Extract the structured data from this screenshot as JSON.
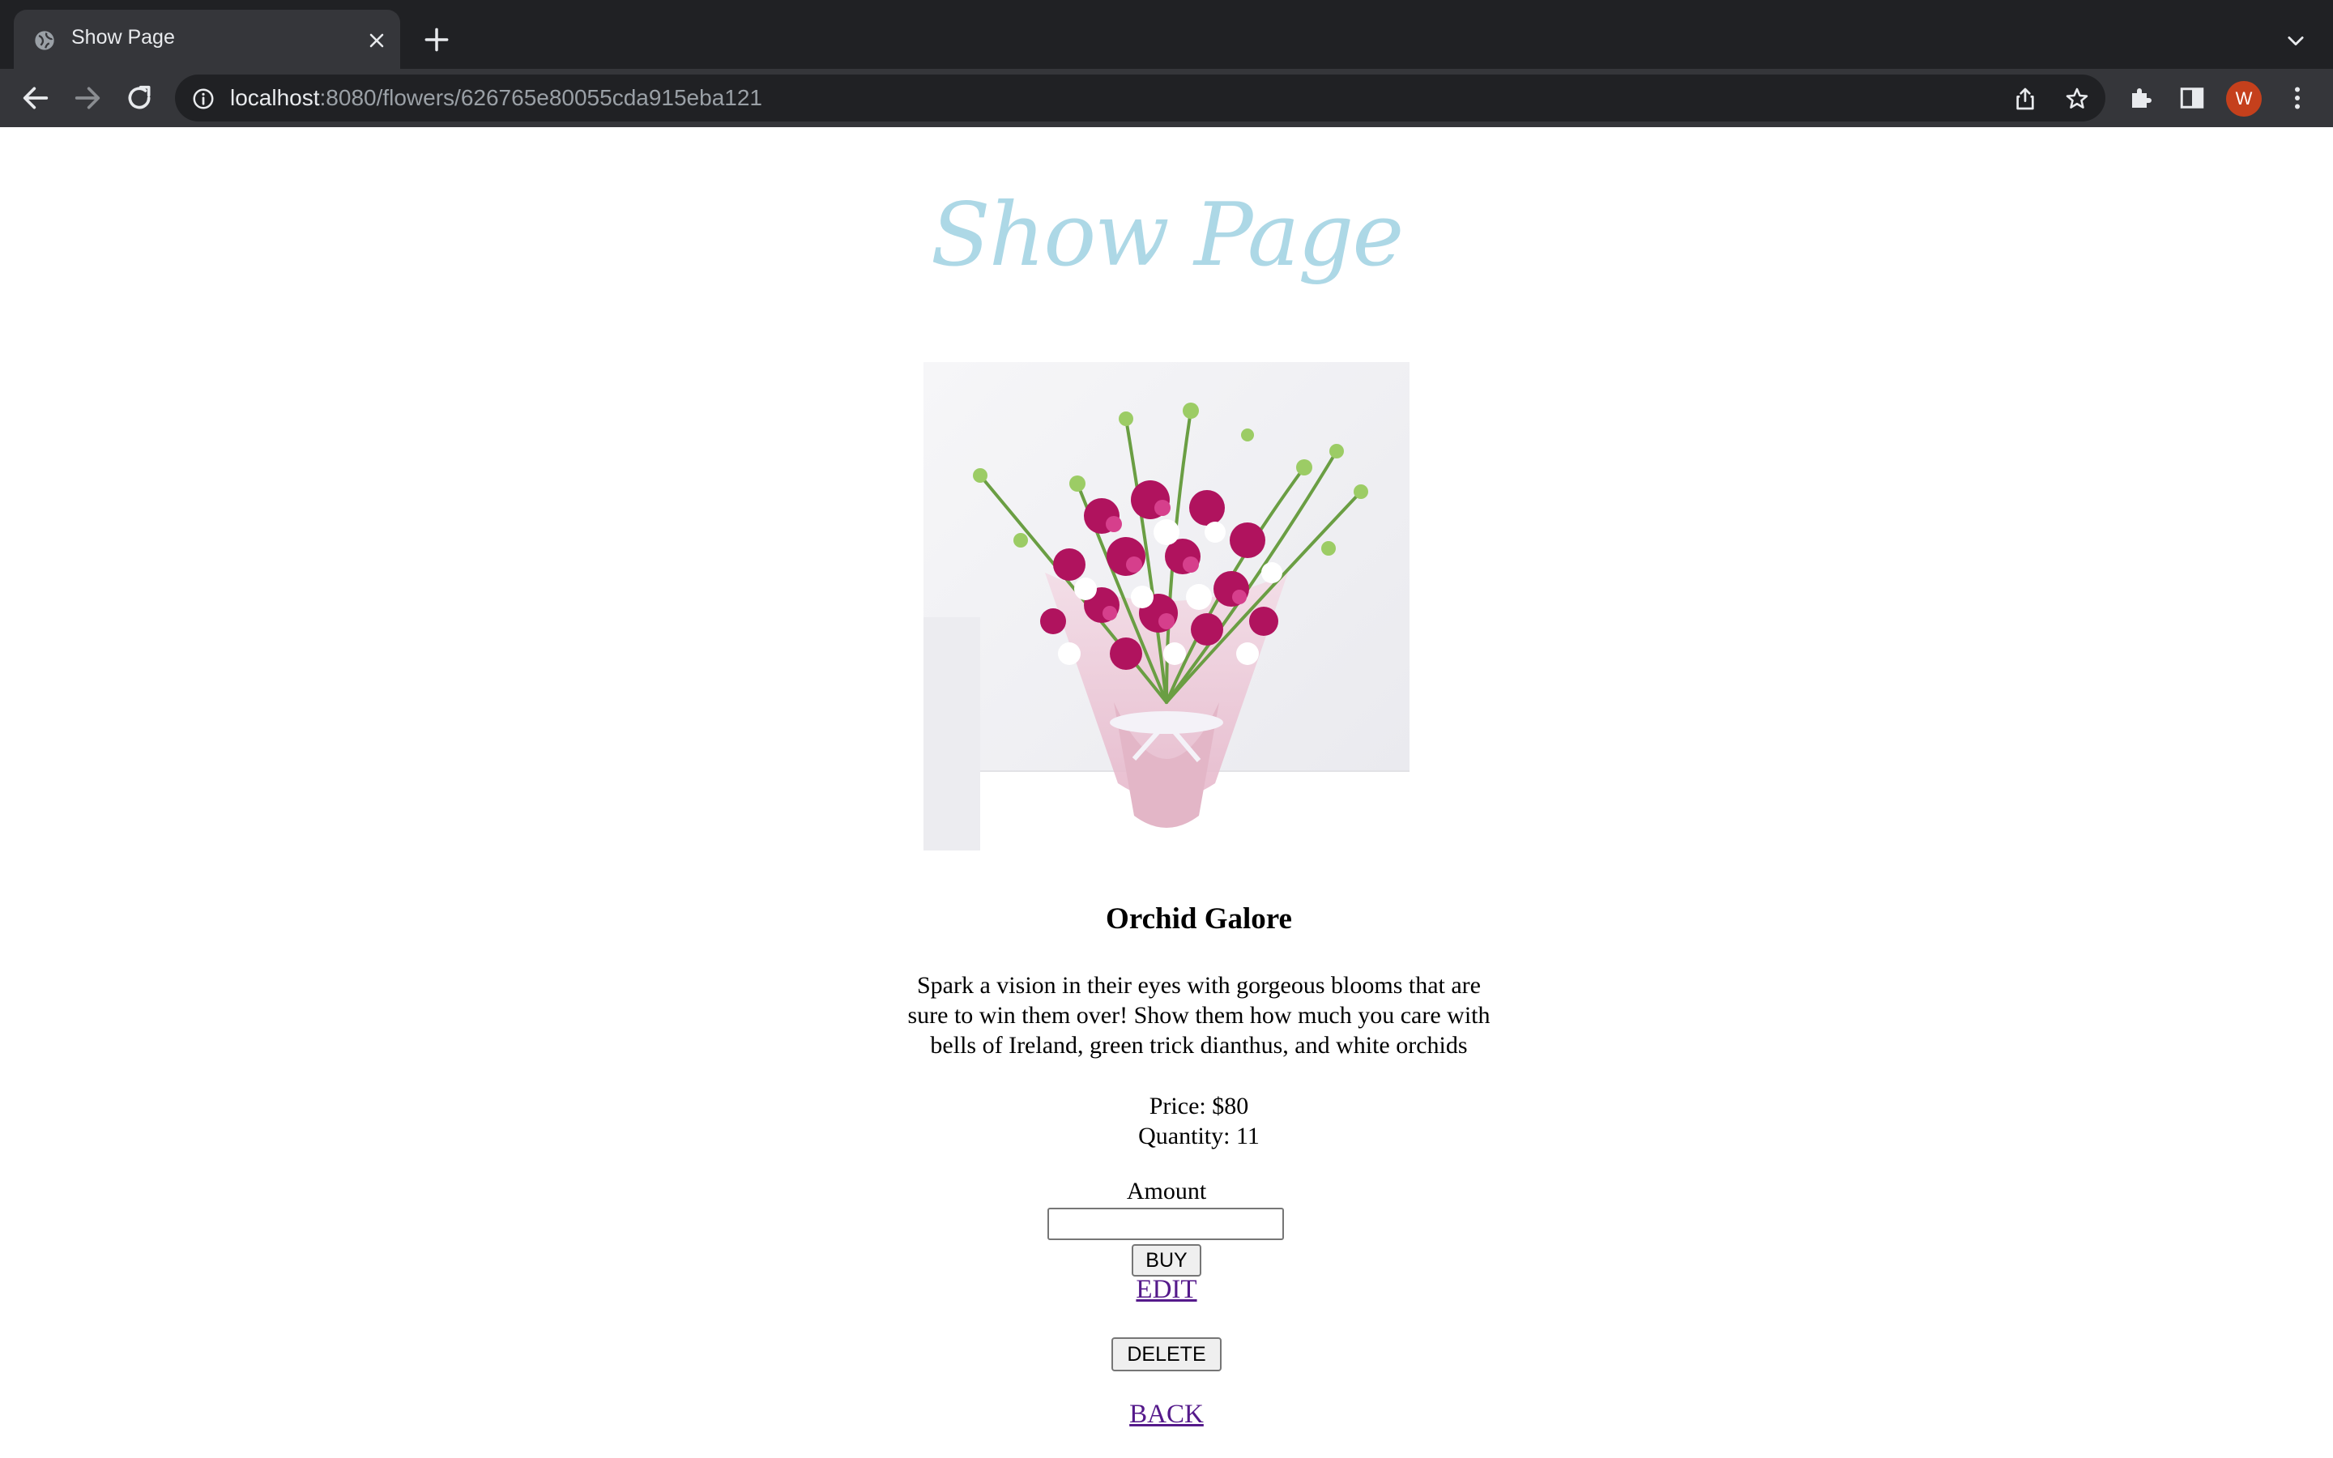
{
  "browser": {
    "tab_title": "Show Page",
    "url_host": "localhost",
    "url_rest": ":8080/flowers/626765e80055cda915eba121",
    "profile_initial": "W",
    "profile_color": "#c5401c"
  },
  "page": {
    "title": "Show Page",
    "title_color": "#add8e6",
    "image_alt": "Orchid bouquet",
    "flower": {
      "name": "Orchid Galore",
      "description": "Spark a vision in their eyes with gorgeous blooms that are sure to win them over! Show them how much you care with bells of Ireland, green trick dianthus, and white orchids",
      "price": "Price: $80",
      "quantity": "Quantity: 11"
    },
    "amount_label": "Amount",
    "amount_value": "",
    "buy_label": "BUY",
    "edit_label": "EDIT",
    "delete_label": "DELETE",
    "back_label": "BACK",
    "link_color": "#551a8b"
  }
}
